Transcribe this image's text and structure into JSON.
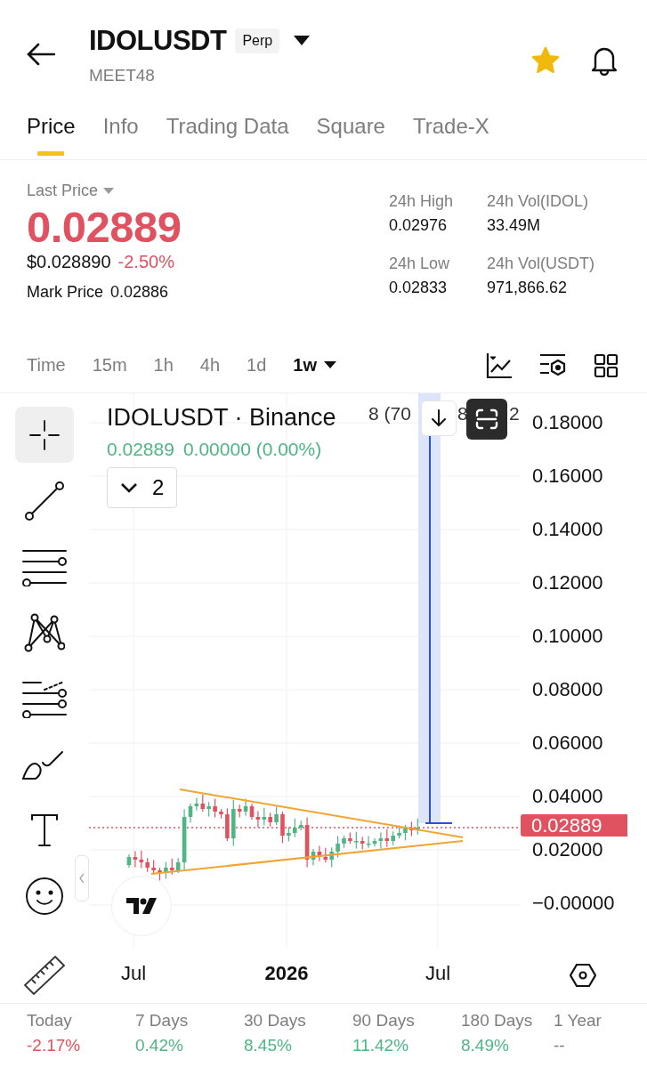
{
  "header": {
    "symbol": "IDOLUSDT",
    "badge": "Perp",
    "subtitle": "MEET48",
    "favorite": true
  },
  "tabs": [
    {
      "label": "Price",
      "selected": true
    },
    {
      "label": "Info",
      "selected": false
    },
    {
      "label": "Trading Data",
      "selected": false
    },
    {
      "label": "Square",
      "selected": false
    },
    {
      "label": "Trade-X",
      "selected": false
    }
  ],
  "price": {
    "label": "Last Price",
    "value": "0.02889",
    "usd": "$0.028890",
    "change": "-2.50%",
    "mark_label": "Mark Price",
    "mark_value": "0.02886"
  },
  "stats": [
    {
      "label": "24h High",
      "value": "0.02976"
    },
    {
      "label": "24h Vol(IDOL)",
      "value": "33.49M"
    },
    {
      "label": "24h Low",
      "value": "0.02833"
    },
    {
      "label": "24h Vol(USDT)",
      "value": "971,866.62"
    }
  ],
  "intervals": [
    {
      "label": "Time",
      "selected": false
    },
    {
      "label": "15m",
      "selected": false
    },
    {
      "label": "1h",
      "selected": false
    },
    {
      "label": "4h",
      "selected": false
    },
    {
      "label": "1d",
      "selected": false
    },
    {
      "label": "1w",
      "selected": true
    }
  ],
  "tools": [
    {
      "kind": "crosshair",
      "selected": true
    },
    {
      "kind": "trendline",
      "selected": false
    },
    {
      "kind": "lines",
      "selected": false
    },
    {
      "kind": "pattern",
      "selected": false
    },
    {
      "kind": "fib",
      "selected": false
    },
    {
      "kind": "brush",
      "selected": false
    },
    {
      "kind": "text",
      "selected": false
    },
    {
      "kind": "emoji",
      "selected": false
    }
  ],
  "chart": {
    "title": "IDOLUSDT · Binance",
    "last": "0.02889",
    "change": "0.00000 (0.00%)",
    "indicators": "2",
    "overlay_label": "8 (70",
    "overlay_fragment": "8",
    "overlay_tail": "2",
    "y_labels": [
      "0.18000",
      "0.16000",
      "0.14000",
      "0.12000",
      "0.10000",
      "0.08000",
      "0.06000",
      "0.04000",
      "0.02000",
      "−0.00000"
    ],
    "price_tag": "0.02889",
    "x_labels": [
      {
        "label": "Jul",
        "bold": false
      },
      {
        "label": "2026",
        "bold": true
      },
      {
        "label": "Jul",
        "bold": false
      }
    ]
  },
  "performance": [
    {
      "label": "Today",
      "value": "-2.17%",
      "color": "#e0525f"
    },
    {
      "label": "7 Days",
      "value": "0.42%",
      "color": "#4fb585"
    },
    {
      "label": "30 Days",
      "value": "8.45%",
      "color": "#4fb585"
    },
    {
      "label": "90 Days",
      "value": "11.42%",
      "color": "#4fb585"
    },
    {
      "label": "180 Days",
      "value": "8.49%",
      "color": "#4fb585"
    },
    {
      "label": "1 Year",
      "value": "--",
      "color": "#7d7d7d"
    }
  ]
}
